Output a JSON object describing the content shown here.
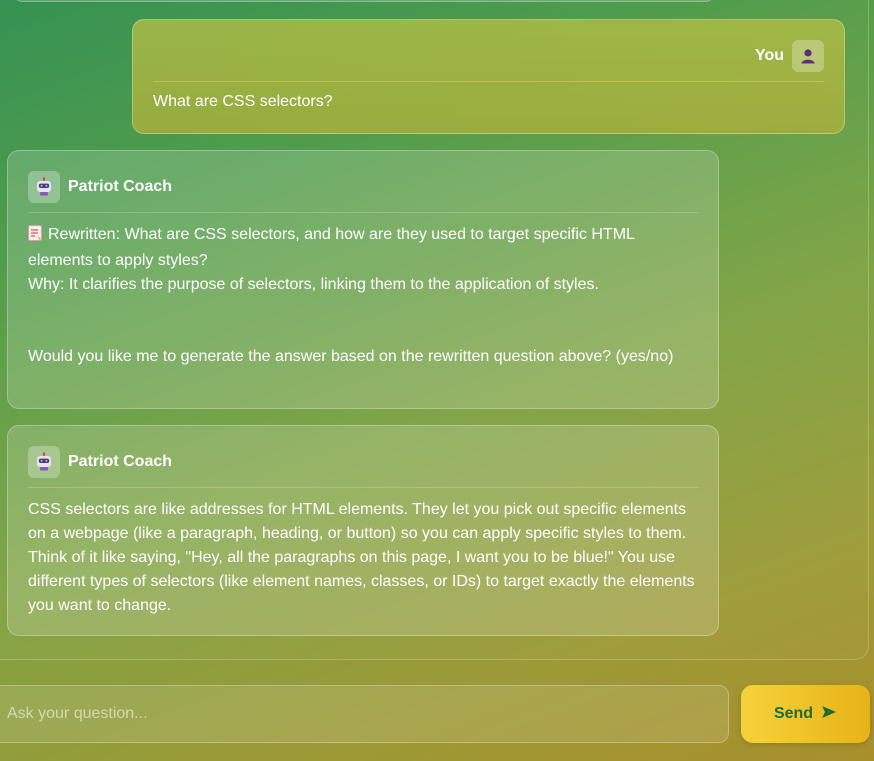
{
  "conversation": {
    "messages": [
      {
        "role": "user",
        "sender": "You",
        "text": "What are CSS selectors?"
      },
      {
        "role": "bot",
        "sender": "Patriot Coach",
        "lines": [
          "Rewritten: What are CSS selectors, and how are they used to target specific HTML elements to apply styles?",
          "Why: It clarifies the purpose of selectors, linking them to the application of styles.",
          "Would you like me to generate the answer based on the rewritten question above? (yes/no)"
        ]
      },
      {
        "role": "bot",
        "sender": "Patriot Coach",
        "text": "CSS selectors are like addresses for HTML elements. They let you pick out specific elements on a webpage (like a paragraph, heading, or button) so you can apply specific styles to them. Think of it like saying, \"Hey, all the paragraphs on this page, I want you to be blue!\" You use different types of selectors (like element names, classes, or IDs) to target exactly the elements you want to change."
      }
    ]
  },
  "composer": {
    "placeholder": "Ask your question...",
    "send_label": "Send",
    "send_icon": "send-arrow-icon"
  },
  "icons": {
    "user_avatar": "user-avatar-icon",
    "bot_avatar": "robot-icon",
    "rewrite_marker": "memo-icon"
  },
  "colors": {
    "send_button": "#f6d23a",
    "send_text": "#1f6b3a",
    "user_avatar_figure": "#5b2f7a"
  }
}
